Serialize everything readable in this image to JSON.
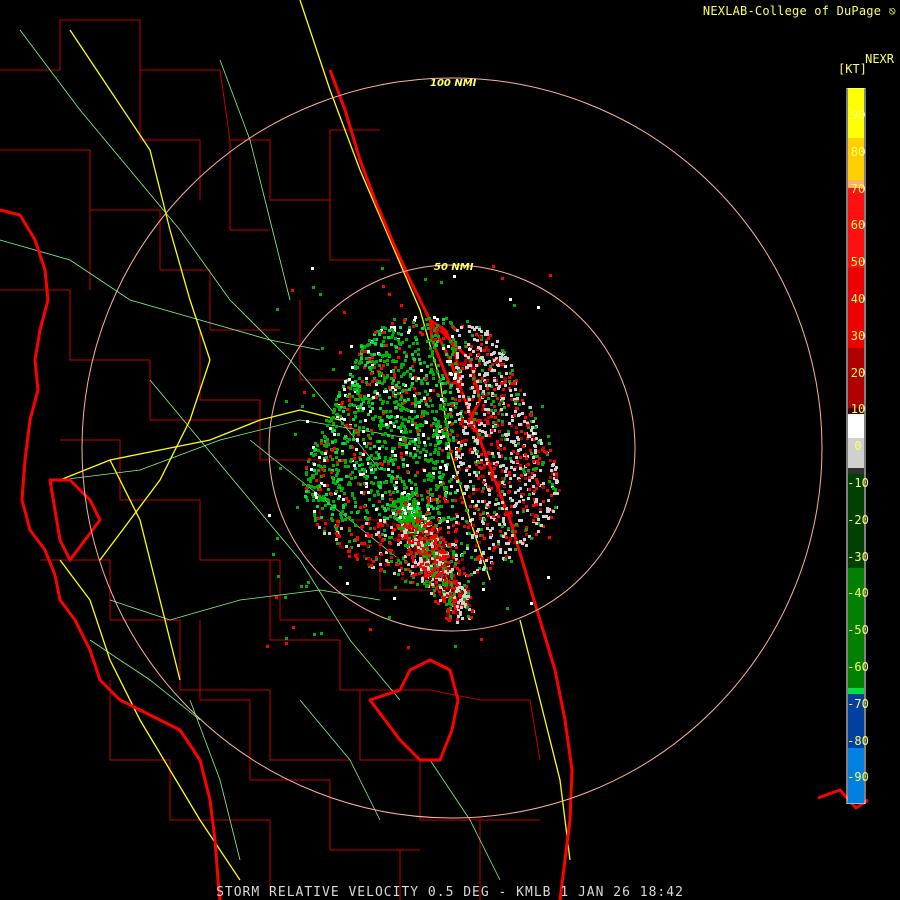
{
  "header": {
    "credit": "NEXLAB-College of DuPage"
  },
  "legend": {
    "product": "NEXR",
    "units": "[KT]",
    "ticks": [
      "90",
      "80",
      "70",
      "60",
      "50",
      "40",
      "30",
      "20",
      "10",
      "0",
      "-10",
      "-20",
      "-30",
      "-40",
      "-50",
      "-60",
      "-70",
      "-80",
      "-90"
    ],
    "colors": {
      "top": "#ffff00",
      "orange": "#ffa060",
      "red": "#ff0000",
      "dark_red": "#5a0000",
      "white": "#ffffff",
      "gray": "#707070",
      "dark_green": "#006000",
      "green": "#00ee44",
      "blue": "#0050c0",
      "light_blue": "#20b0ff"
    }
  },
  "map": {
    "range_rings": [
      {
        "label": "50 NMI"
      },
      {
        "label": "100 NMI"
      }
    ],
    "colors": {
      "coastline": "#ff0000",
      "county_lines": "#c00000",
      "highways": "#ffff00",
      "roads": "#80ff80",
      "rings": "#ffb0a0"
    }
  },
  "footer": {
    "title": "STORM RELATIVE VELOCITY 0.5 DEG - KMLB 1 JAN 26 18:42"
  }
}
